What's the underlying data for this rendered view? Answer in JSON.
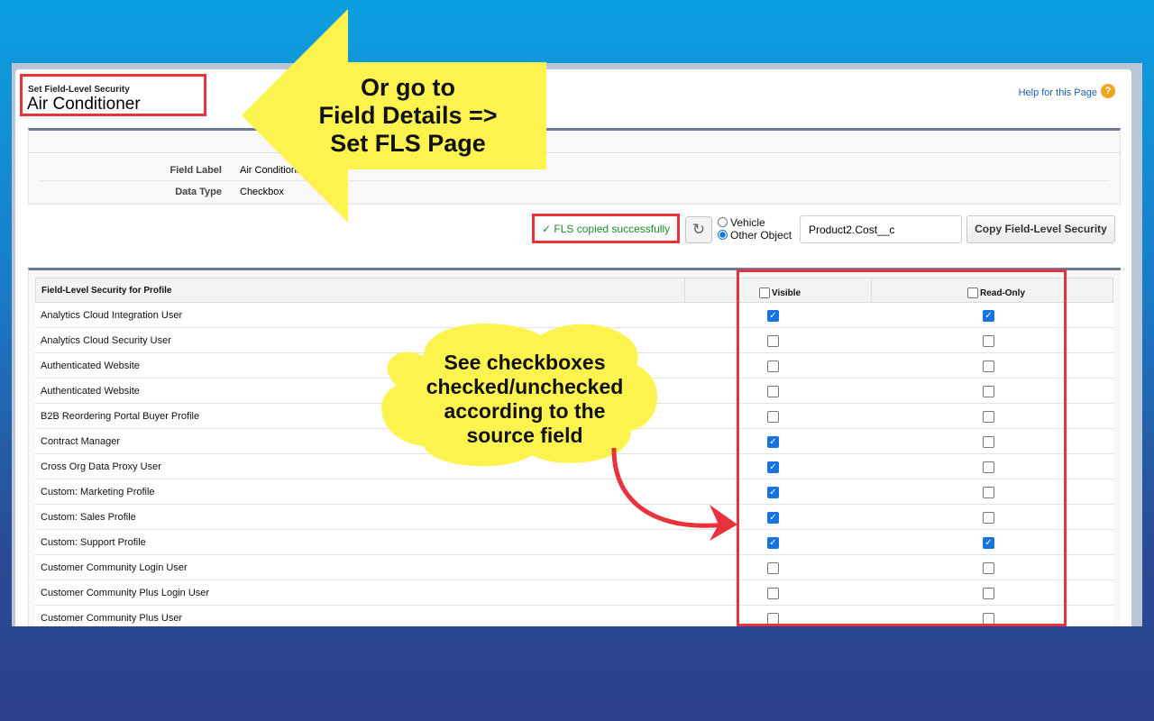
{
  "header": {
    "breadcrumb": "Set Field-Level Security",
    "title": "Air Conditioner",
    "help_link": "Help for this Page",
    "help_icon": "?"
  },
  "details": [
    {
      "label": "Field Label",
      "value": "Air Conditioner"
    },
    {
      "label": "Data Type",
      "value": "Checkbox"
    }
  ],
  "toolbar": {
    "status": "FLS copied successfully",
    "status_icon": "✓",
    "refresh_icon": "↻",
    "radio_options": [
      "Vehicle",
      "Other Object"
    ],
    "selected_radio": "Other Object",
    "field_value": "Product2.Cost__c",
    "copy_button": "Copy Field-Level Security"
  },
  "table": {
    "header_profile": "Field-Level Security for Profile",
    "header_visible": "Visible",
    "header_readonly": "Read-Only",
    "rows": [
      {
        "profile": "Analytics Cloud Integration User",
        "visible": true,
        "readonly": true
      },
      {
        "profile": "Analytics Cloud Security User",
        "visible": false,
        "readonly": false
      },
      {
        "profile": "Authenticated Website",
        "visible": false,
        "readonly": false
      },
      {
        "profile": "Authenticated Website",
        "visible": false,
        "readonly": false
      },
      {
        "profile": "B2B Reordering Portal Buyer Profile",
        "visible": false,
        "readonly": false
      },
      {
        "profile": "Contract Manager",
        "visible": true,
        "readonly": false
      },
      {
        "profile": "Cross Org Data Proxy User",
        "visible": true,
        "readonly": false
      },
      {
        "profile": "Custom: Marketing Profile",
        "visible": true,
        "readonly": false
      },
      {
        "profile": "Custom: Sales Profile",
        "visible": true,
        "readonly": false
      },
      {
        "profile": "Custom: Support Profile",
        "visible": true,
        "readonly": true
      },
      {
        "profile": "Customer Community Login User",
        "visible": false,
        "readonly": false
      },
      {
        "profile": "Customer Community Plus Login User",
        "visible": false,
        "readonly": false
      },
      {
        "profile": "Customer Community Plus User",
        "visible": false,
        "readonly": false
      }
    ]
  },
  "callouts": {
    "arrow_lines": [
      "Or go to",
      "Field Details =>",
      "Set FLS Page"
    ],
    "cloud_lines": [
      "See checkboxes",
      "checked/unchecked",
      "according to the",
      "source field"
    ]
  },
  "colors": {
    "highlight": "#e8323c",
    "callout_fill": "#fdf34f",
    "checkbox_on": "#1673e0",
    "status_text": "#1e8a2a"
  }
}
